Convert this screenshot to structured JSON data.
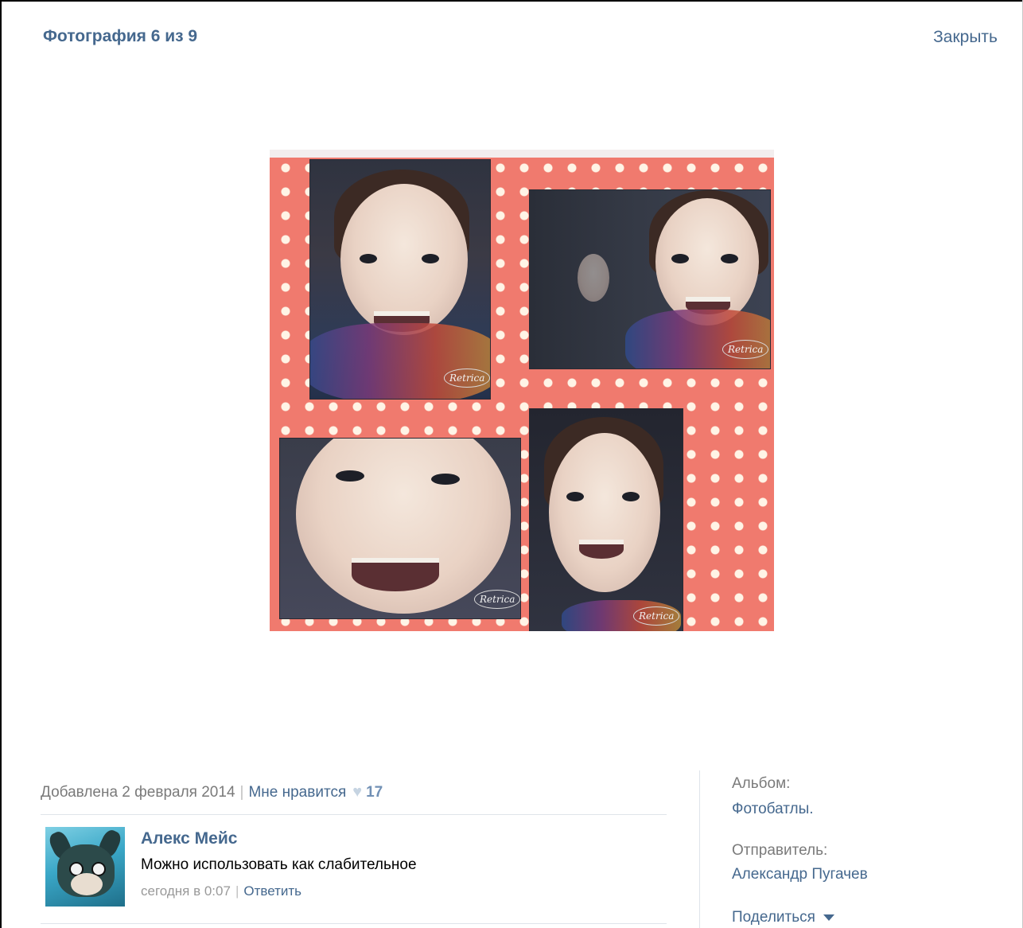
{
  "header": {
    "title": "Фотография 6 из 9",
    "close_label": "Закрыть"
  },
  "photo": {
    "watermark": "Retrica"
  },
  "info": {
    "added": "Добавлена 2 февраля 2014",
    "like_label": "Мне нравится",
    "like_count": "17"
  },
  "comment": {
    "author": "Алекс Мейс",
    "text": "Можно использовать как слабительное",
    "time": "сегодня в 0:07",
    "reply_label": "Ответить"
  },
  "sidebar": {
    "album_label": "Альбом:",
    "album_value": "Фотобатлы.",
    "sender_label": "Отправитель:",
    "sender_value": "Александр Пугачев",
    "share_label": "Поделиться"
  },
  "colors": {
    "link": "#45688e",
    "muted": "#7a7a7a",
    "polka_bg": "#f07a6e"
  }
}
